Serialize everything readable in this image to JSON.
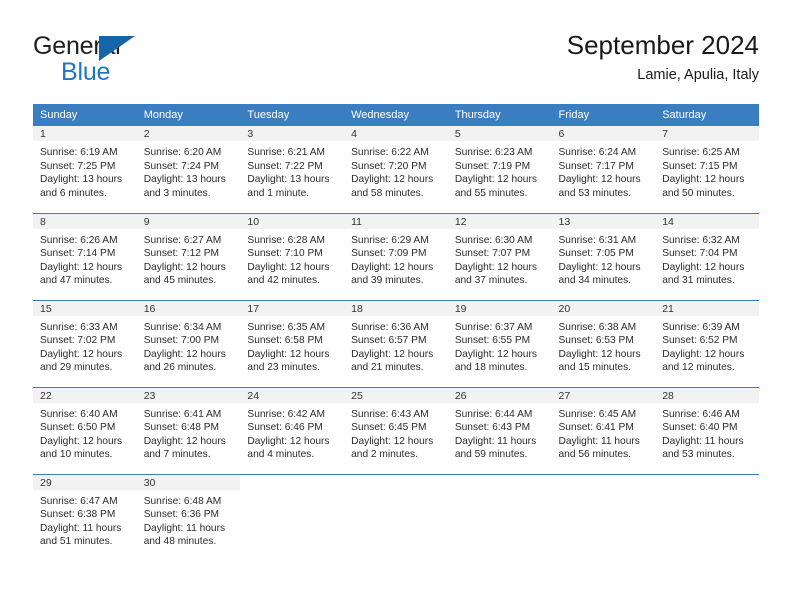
{
  "brand": {
    "name_part1": "General",
    "name_part2": "Blue",
    "triangle_color": "#1565a8",
    "accent_color": "#1f77c4"
  },
  "header": {
    "title": "September 2024",
    "location": "Lamie, Apulia, Italy"
  },
  "theme": {
    "header_row_bg": "#3a7dc0",
    "day_band_bg": "#f2f2f2",
    "cell_bg": "#ffffff",
    "row_divider": "#3a7dc0",
    "text_color": "#2b2b2b"
  },
  "weekday_headers": [
    "Sunday",
    "Monday",
    "Tuesday",
    "Wednesday",
    "Thursday",
    "Friday",
    "Saturday"
  ],
  "weeks": [
    [
      {
        "day": "1",
        "sunrise": "Sunrise: 6:19 AM",
        "sunset": "Sunset: 7:25 PM",
        "daylight1": "Daylight: 13 hours",
        "daylight2": "and 6 minutes."
      },
      {
        "day": "2",
        "sunrise": "Sunrise: 6:20 AM",
        "sunset": "Sunset: 7:24 PM",
        "daylight1": "Daylight: 13 hours",
        "daylight2": "and 3 minutes."
      },
      {
        "day": "3",
        "sunrise": "Sunrise: 6:21 AM",
        "sunset": "Sunset: 7:22 PM",
        "daylight1": "Daylight: 13 hours",
        "daylight2": "and 1 minute."
      },
      {
        "day": "4",
        "sunrise": "Sunrise: 6:22 AM",
        "sunset": "Sunset: 7:20 PM",
        "daylight1": "Daylight: 12 hours",
        "daylight2": "and 58 minutes."
      },
      {
        "day": "5",
        "sunrise": "Sunrise: 6:23 AM",
        "sunset": "Sunset: 7:19 PM",
        "daylight1": "Daylight: 12 hours",
        "daylight2": "and 55 minutes."
      },
      {
        "day": "6",
        "sunrise": "Sunrise: 6:24 AM",
        "sunset": "Sunset: 7:17 PM",
        "daylight1": "Daylight: 12 hours",
        "daylight2": "and 53 minutes."
      },
      {
        "day": "7",
        "sunrise": "Sunrise: 6:25 AM",
        "sunset": "Sunset: 7:15 PM",
        "daylight1": "Daylight: 12 hours",
        "daylight2": "and 50 minutes."
      }
    ],
    [
      {
        "day": "8",
        "sunrise": "Sunrise: 6:26 AM",
        "sunset": "Sunset: 7:14 PM",
        "daylight1": "Daylight: 12 hours",
        "daylight2": "and 47 minutes."
      },
      {
        "day": "9",
        "sunrise": "Sunrise: 6:27 AM",
        "sunset": "Sunset: 7:12 PM",
        "daylight1": "Daylight: 12 hours",
        "daylight2": "and 45 minutes."
      },
      {
        "day": "10",
        "sunrise": "Sunrise: 6:28 AM",
        "sunset": "Sunset: 7:10 PM",
        "daylight1": "Daylight: 12 hours",
        "daylight2": "and 42 minutes."
      },
      {
        "day": "11",
        "sunrise": "Sunrise: 6:29 AM",
        "sunset": "Sunset: 7:09 PM",
        "daylight1": "Daylight: 12 hours",
        "daylight2": "and 39 minutes."
      },
      {
        "day": "12",
        "sunrise": "Sunrise: 6:30 AM",
        "sunset": "Sunset: 7:07 PM",
        "daylight1": "Daylight: 12 hours",
        "daylight2": "and 37 minutes."
      },
      {
        "day": "13",
        "sunrise": "Sunrise: 6:31 AM",
        "sunset": "Sunset: 7:05 PM",
        "daylight1": "Daylight: 12 hours",
        "daylight2": "and 34 minutes."
      },
      {
        "day": "14",
        "sunrise": "Sunrise: 6:32 AM",
        "sunset": "Sunset: 7:04 PM",
        "daylight1": "Daylight: 12 hours",
        "daylight2": "and 31 minutes."
      }
    ],
    [
      {
        "day": "15",
        "sunrise": "Sunrise: 6:33 AM",
        "sunset": "Sunset: 7:02 PM",
        "daylight1": "Daylight: 12 hours",
        "daylight2": "and 29 minutes."
      },
      {
        "day": "16",
        "sunrise": "Sunrise: 6:34 AM",
        "sunset": "Sunset: 7:00 PM",
        "daylight1": "Daylight: 12 hours",
        "daylight2": "and 26 minutes."
      },
      {
        "day": "17",
        "sunrise": "Sunrise: 6:35 AM",
        "sunset": "Sunset: 6:58 PM",
        "daylight1": "Daylight: 12 hours",
        "daylight2": "and 23 minutes."
      },
      {
        "day": "18",
        "sunrise": "Sunrise: 6:36 AM",
        "sunset": "Sunset: 6:57 PM",
        "daylight1": "Daylight: 12 hours",
        "daylight2": "and 21 minutes."
      },
      {
        "day": "19",
        "sunrise": "Sunrise: 6:37 AM",
        "sunset": "Sunset: 6:55 PM",
        "daylight1": "Daylight: 12 hours",
        "daylight2": "and 18 minutes."
      },
      {
        "day": "20",
        "sunrise": "Sunrise: 6:38 AM",
        "sunset": "Sunset: 6:53 PM",
        "daylight1": "Daylight: 12 hours",
        "daylight2": "and 15 minutes."
      },
      {
        "day": "21",
        "sunrise": "Sunrise: 6:39 AM",
        "sunset": "Sunset: 6:52 PM",
        "daylight1": "Daylight: 12 hours",
        "daylight2": "and 12 minutes."
      }
    ],
    [
      {
        "day": "22",
        "sunrise": "Sunrise: 6:40 AM",
        "sunset": "Sunset: 6:50 PM",
        "daylight1": "Daylight: 12 hours",
        "daylight2": "and 10 minutes."
      },
      {
        "day": "23",
        "sunrise": "Sunrise: 6:41 AM",
        "sunset": "Sunset: 6:48 PM",
        "daylight1": "Daylight: 12 hours",
        "daylight2": "and 7 minutes."
      },
      {
        "day": "24",
        "sunrise": "Sunrise: 6:42 AM",
        "sunset": "Sunset: 6:46 PM",
        "daylight1": "Daylight: 12 hours",
        "daylight2": "and 4 minutes."
      },
      {
        "day": "25",
        "sunrise": "Sunrise: 6:43 AM",
        "sunset": "Sunset: 6:45 PM",
        "daylight1": "Daylight: 12 hours",
        "daylight2": "and 2 minutes."
      },
      {
        "day": "26",
        "sunrise": "Sunrise: 6:44 AM",
        "sunset": "Sunset: 6:43 PM",
        "daylight1": "Daylight: 11 hours",
        "daylight2": "and 59 minutes."
      },
      {
        "day": "27",
        "sunrise": "Sunrise: 6:45 AM",
        "sunset": "Sunset: 6:41 PM",
        "daylight1": "Daylight: 11 hours",
        "daylight2": "and 56 minutes."
      },
      {
        "day": "28",
        "sunrise": "Sunrise: 6:46 AM",
        "sunset": "Sunset: 6:40 PM",
        "daylight1": "Daylight: 11 hours",
        "daylight2": "and 53 minutes."
      }
    ],
    [
      {
        "day": "29",
        "sunrise": "Sunrise: 6:47 AM",
        "sunset": "Sunset: 6:38 PM",
        "daylight1": "Daylight: 11 hours",
        "daylight2": "and 51 minutes."
      },
      {
        "day": "30",
        "sunrise": "Sunrise: 6:48 AM",
        "sunset": "Sunset: 6:36 PM",
        "daylight1": "Daylight: 11 hours",
        "daylight2": "and 48 minutes."
      },
      {
        "day": "",
        "sunrise": "",
        "sunset": "",
        "daylight1": "",
        "daylight2": ""
      },
      {
        "day": "",
        "sunrise": "",
        "sunset": "",
        "daylight1": "",
        "daylight2": ""
      },
      {
        "day": "",
        "sunrise": "",
        "sunset": "",
        "daylight1": "",
        "daylight2": ""
      },
      {
        "day": "",
        "sunrise": "",
        "sunset": "",
        "daylight1": "",
        "daylight2": ""
      },
      {
        "day": "",
        "sunrise": "",
        "sunset": "",
        "daylight1": "",
        "daylight2": ""
      }
    ]
  ]
}
